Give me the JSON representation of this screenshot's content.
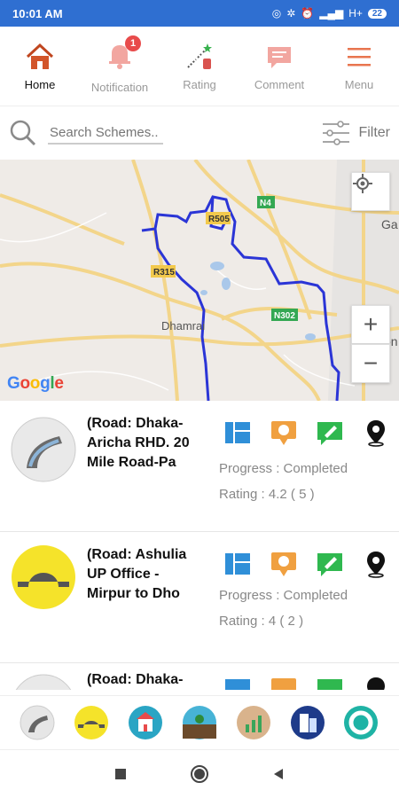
{
  "status_bar": {
    "time": "10:01 AM",
    "network": "H+",
    "battery": "22"
  },
  "tabs": [
    {
      "label": "Home",
      "icon": "home-icon"
    },
    {
      "label": "Notification",
      "icon": "bell-icon",
      "badge": "1"
    },
    {
      "label": "Rating",
      "icon": "rating-icon"
    },
    {
      "label": "Comment",
      "icon": "comment-icon"
    },
    {
      "label": "Menu",
      "icon": "menu-icon"
    }
  ],
  "search": {
    "placeholder": "Search Schemes..",
    "filter_label": "Filter"
  },
  "map": {
    "labels": [
      "R505",
      "N4",
      "R315",
      "N302",
      "Dhamrai",
      "Ga",
      "Ton"
    ],
    "zoom_in": "+",
    "zoom_out": "−",
    "attribution": "Google"
  },
  "schemes": [
    {
      "title": "(Road: Dhaka-Aricha RHD. 20 Mile Road-Pa",
      "progress_label": "Progress :",
      "progress": "Completed",
      "rating_label": "Rating :",
      "rating": "4.2",
      "rating_count": "( 5 )"
    },
    {
      "title": "(Road: Ashulia UP Office - Mirpur to Dho",
      "progress_label": "Progress :",
      "progress": "Completed",
      "rating_label": "Rating :",
      "rating": "4",
      "rating_count": "( 2 )"
    },
    {
      "title": "(Road: Dhaka-",
      "progress_label": "",
      "progress": "",
      "rating_label": "",
      "rating": "",
      "rating_count": ""
    }
  ],
  "colors": {
    "accent": "#e8754f",
    "status_bar": "#2f6fd1",
    "route": "#2b35d6",
    "layout_icon": "#2f8fd8",
    "award_icon": "#f0a040",
    "edit_icon": "#2fb84f"
  },
  "categories": [
    "road-category-icon",
    "bridge-category-icon",
    "school-category-icon",
    "island-category-icon",
    "growth-category-icon",
    "building-category-icon",
    "lifebuoy-category-icon"
  ]
}
